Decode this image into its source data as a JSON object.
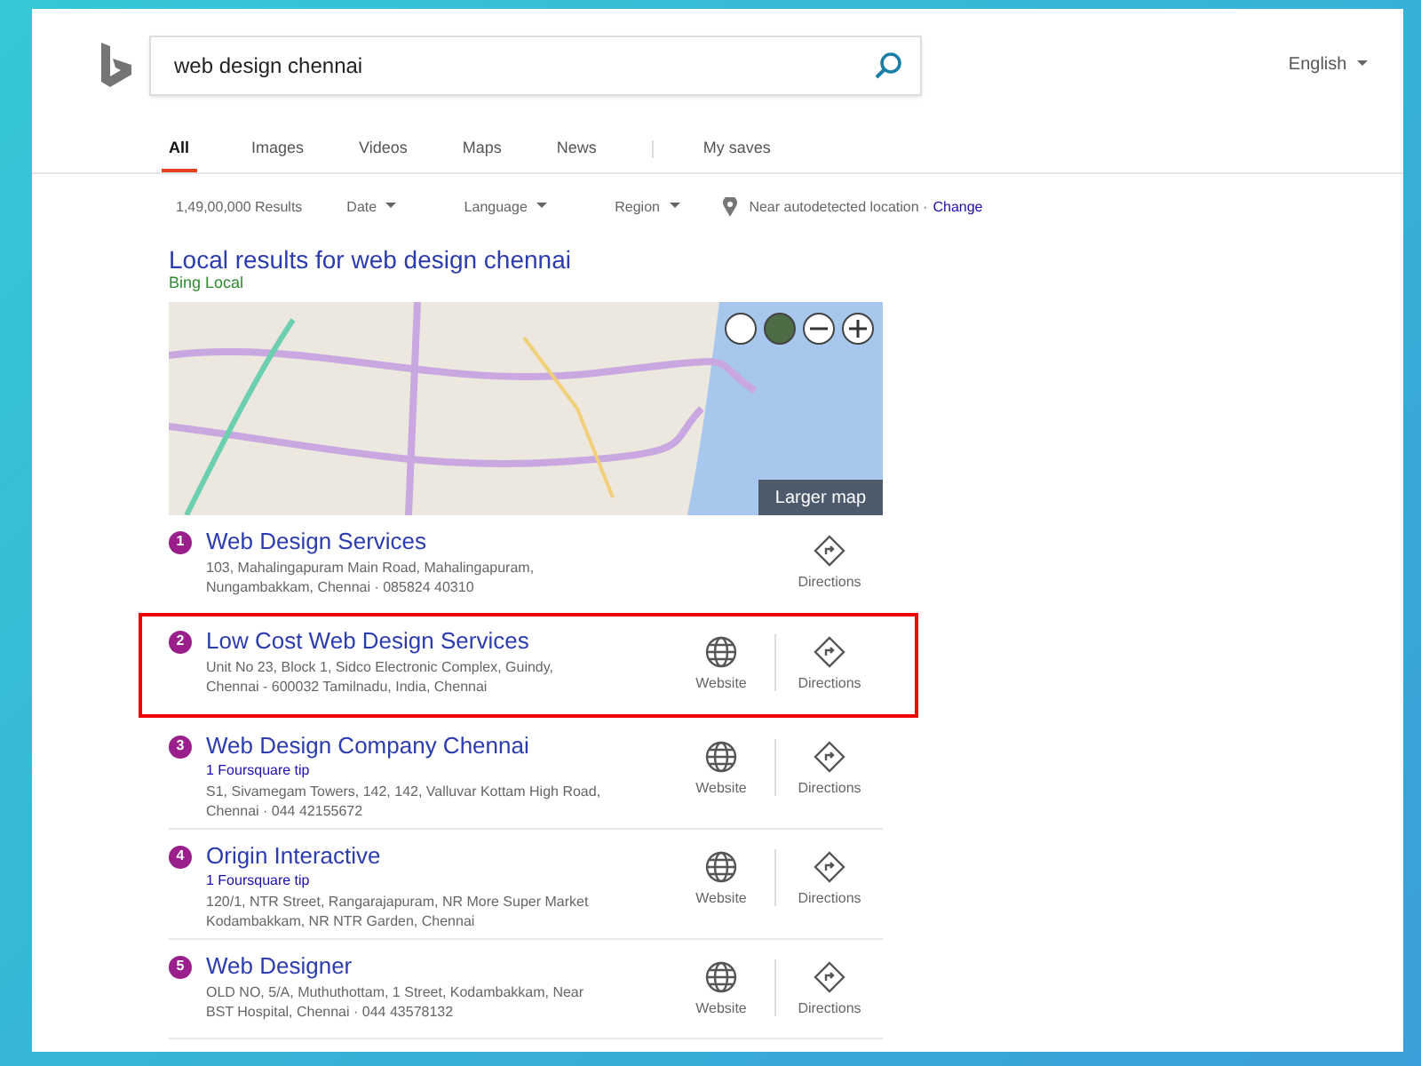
{
  "search": {
    "value": "web design chennai"
  },
  "language": "English",
  "tabs": [
    {
      "label": "All",
      "selected": true
    },
    {
      "label": "Images",
      "selected": false
    },
    {
      "label": "Videos",
      "selected": false
    },
    {
      "label": "Maps",
      "selected": false
    },
    {
      "label": "News",
      "selected": false
    },
    {
      "label": "My saves",
      "selected": false
    }
  ],
  "filters": {
    "count": "1,49,00,000 Results",
    "dropdowns": [
      "Date",
      "Language",
      "Region"
    ],
    "location": "Near autodetected location ·",
    "change_link": "Change"
  },
  "local": {
    "title": "Local results for web design chennai",
    "source": "Bing Local",
    "map_button": "Larger map"
  },
  "results": [
    {
      "number": "1",
      "name": "Web Design Services",
      "address": "103, Mahalingapuram Main Road, Mahalingapuram, Nungambakkam, Chennai · 085824 40310",
      "directions": "Directions",
      "highlighted": false
    },
    {
      "number": "2",
      "name": "Low Cost Web Design Services",
      "address": "Unit No 23, Block 1, Sidco Electronic Complex, Guindy, Chennai - 600032 Tamilnadu, India, Chennai",
      "website": "Website",
      "directions": "Directions",
      "highlighted": true
    },
    {
      "number": "3",
      "name": "Web Design Company Chennai",
      "tip": "1 Foursquare tip",
      "address": "S1, Sivamegam Towers, 142, 142, Valluvar Kottam High Road, Chennai · 044 42155672",
      "website": "Website",
      "directions": "Directions",
      "highlighted": false
    },
    {
      "number": "4",
      "name": "Origin Interactive",
      "tip": "1 Foursquare tip",
      "address": "120/1, NTR Street, Rangarajapuram, NR More Super Market Kodambakkam, NR NTR Garden, Chennai",
      "website": "Website",
      "directions": "Directions",
      "highlighted": false
    },
    {
      "number": "5",
      "name": "Web Designer",
      "address": "OLD NO, 5/A, Muthuthottam, 1 Street, Kodambakkam, Near BST Hospital, Chennai · 044 43578132",
      "website": "Website",
      "directions": "Directions",
      "highlighted": false
    }
  ]
}
